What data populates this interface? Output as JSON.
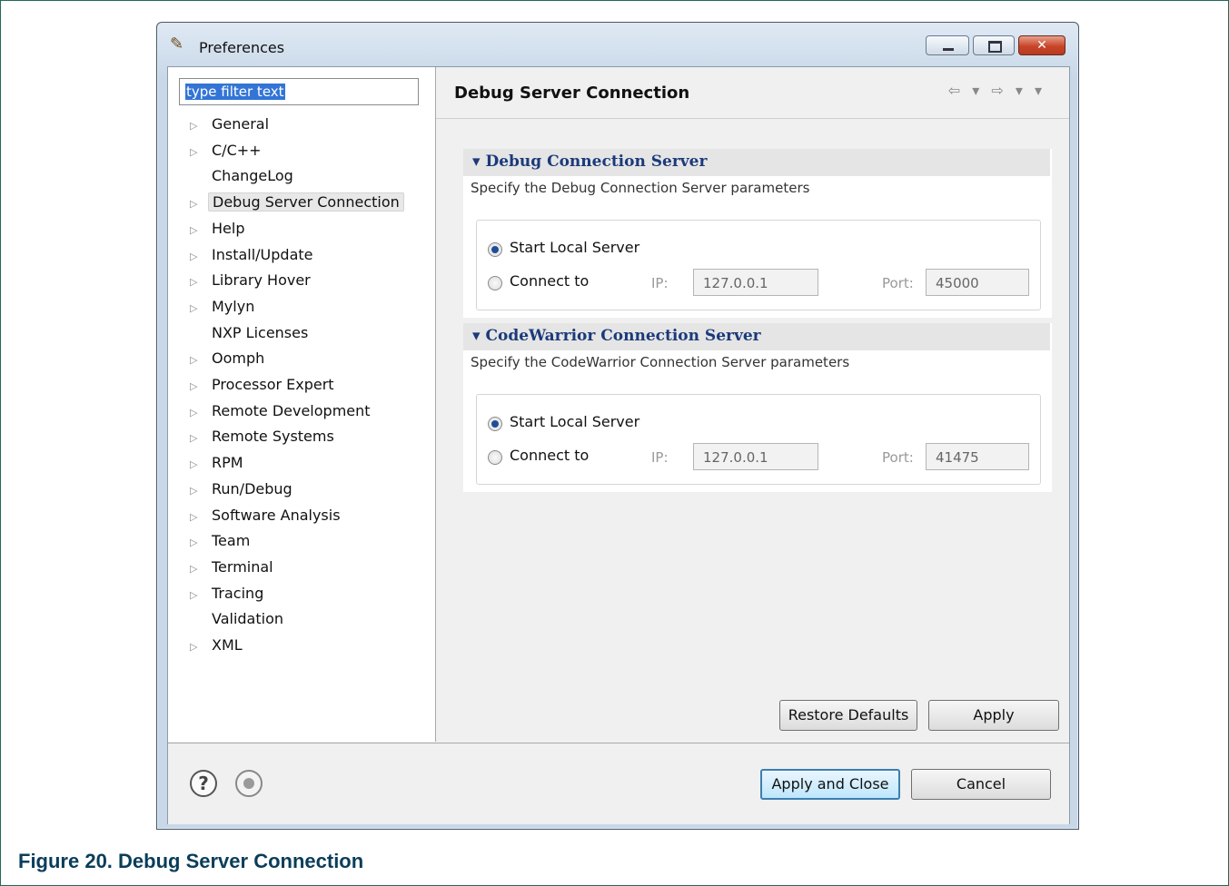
{
  "window": {
    "title": "Preferences",
    "close_glyph": "✕"
  },
  "filter": {
    "value": "type filter text"
  },
  "tree": {
    "items": [
      {
        "label": "General",
        "expandable": true
      },
      {
        "label": "C/C++",
        "expandable": true
      },
      {
        "label": "ChangeLog",
        "expandable": false
      },
      {
        "label": "Debug Server Connection",
        "expandable": true,
        "selected": true
      },
      {
        "label": "Help",
        "expandable": true
      },
      {
        "label": "Install/Update",
        "expandable": true
      },
      {
        "label": "Library Hover",
        "expandable": true
      },
      {
        "label": "Mylyn",
        "expandable": true
      },
      {
        "label": "NXP Licenses",
        "expandable": false
      },
      {
        "label": "Oomph",
        "expandable": true
      },
      {
        "label": "Processor Expert",
        "expandable": true
      },
      {
        "label": "Remote Development",
        "expandable": true
      },
      {
        "label": "Remote Systems",
        "expandable": true
      },
      {
        "label": "RPM",
        "expandable": true
      },
      {
        "label": "Run/Debug",
        "expandable": true
      },
      {
        "label": "Software Analysis",
        "expandable": true
      },
      {
        "label": "Team",
        "expandable": true
      },
      {
        "label": "Terminal",
        "expandable": true
      },
      {
        "label": "Tracing",
        "expandable": true
      },
      {
        "label": "Validation",
        "expandable": false
      },
      {
        "label": "XML",
        "expandable": true
      }
    ]
  },
  "page": {
    "title": "Debug Server Connection",
    "nav_glyphs": "⇦ ▾ ⇨ ▾ ▾"
  },
  "sections": [
    {
      "title": "Debug Connection Server",
      "description": "Specify the Debug Connection Server parameters",
      "start_local_label": "Start Local Server",
      "connect_to_label": "Connect to",
      "start_local_selected": true,
      "ip_label": "IP:",
      "ip_value": "127.0.0.1",
      "port_label": "Port:",
      "port_value": "45000"
    },
    {
      "title": "CodeWarrior Connection Server",
      "description": "Specify the CodeWarrior Connection Server parameters",
      "start_local_label": "Start Local Server",
      "connect_to_label": "Connect to",
      "start_local_selected": true,
      "ip_label": "IP:",
      "ip_value": "127.0.0.1",
      "port_label": "Port:",
      "port_value": "41475"
    }
  ],
  "buttons": {
    "restore_defaults": "Restore Defaults",
    "apply": "Apply",
    "apply_and_close": "Apply and Close",
    "cancel": "Cancel"
  },
  "caption": "Figure 20.  Debug Server Connection",
  "colors": {
    "accent": "#1b3a7a",
    "selection": "#3375d6",
    "caption": "#0a3d5a"
  }
}
